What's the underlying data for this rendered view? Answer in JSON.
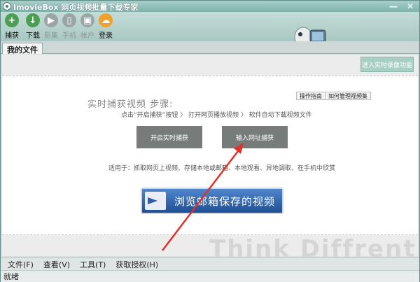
{
  "window": {
    "title": "ImovieBox 网页视频批量下载专家",
    "minimize": "—",
    "close": "✕"
  },
  "toolbar": {
    "items": [
      {
        "label": "捕获",
        "icon": "plus-icon",
        "glyph": "+"
      },
      {
        "label": "下载",
        "icon": "download-icon",
        "glyph": "↓"
      },
      {
        "label": "影集",
        "icon": "play-icon",
        "glyph": "▶"
      },
      {
        "label": "手机",
        "icon": "phone-icon",
        "glyph": "▯"
      },
      {
        "label": "帐户",
        "icon": "lock-icon",
        "glyph": "▣"
      },
      {
        "label": "登录",
        "icon": "cloud-icon",
        "glyph": "☁"
      }
    ]
  },
  "tabs": [
    {
      "label": "我的文件",
      "active": true
    }
  ],
  "main": {
    "realtime_button": "进入实时录像功能",
    "steps_title": "实时捕获视频 步骤:",
    "guide_button": "操作指南",
    "manage_button": "如何管理视频集",
    "steps_line": "点击“开启捕获”按钮 〉 打开网页播放视频 〉 软件自动下载视频文件",
    "start_capture_button": "开启实时捕获",
    "url_capture_button": "输入网址捕获",
    "usage_text": "适用于：抓取网页上视频、存储本地或邮箱、本地观看、异地调取、在手机中欣赏",
    "browse_button": "浏览邮箱保存的视频",
    "watermark": "Think Diffrent"
  },
  "menubar": {
    "items": [
      "文件(F)",
      "查看(V)",
      "工具(T)",
      "获取授权(H)"
    ]
  },
  "statusbar": {
    "text": "就绪"
  },
  "colors": {
    "titlebar": "#7db3aa",
    "accent_green": "#4c9e52",
    "browse_blue": "#1f4f94",
    "annotation_red": "#e0312b"
  }
}
